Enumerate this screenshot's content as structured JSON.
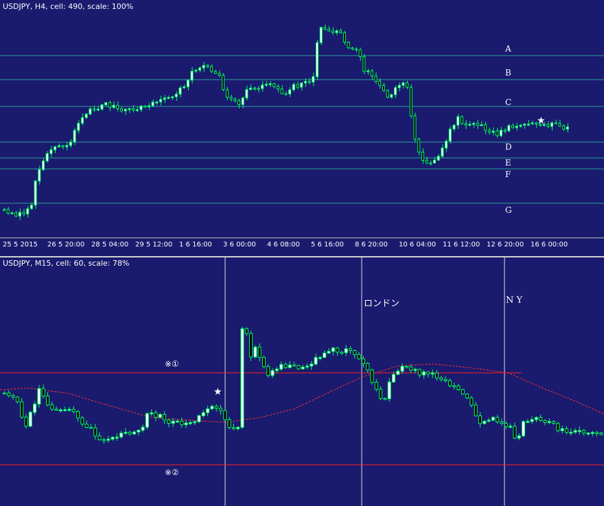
{
  "top_pane": {
    "title": "USDJPY, H4, cell: 490, scale: 100%",
    "levels": [
      {
        "label": "A"
      },
      {
        "label": "B"
      },
      {
        "label": "C"
      },
      {
        "label": "D"
      },
      {
        "label": "E"
      },
      {
        "label": "F"
      },
      {
        "label": "G"
      }
    ],
    "level_color": "#2aa198",
    "candle_up_color": "#ffffff",
    "candle_down_color": "#000000",
    "wick_color": "#00ff66",
    "marker_symbol": "★",
    "x_ticks": [
      "25 5 2015",
      "26 5 20:00",
      "28 5 04:00",
      "29 5 12:00",
      "1 6 16:00",
      "3 6 00:00",
      "4 6 08:00",
      "5 6 16:00",
      "8 6 20:00",
      "10 6 04:00",
      "11 6 12:00",
      "12 6 20:00",
      "16 6 00:00"
    ]
  },
  "bottom_pane": {
    "title": "USDJPY, M15, cell: 60, scale: 78%",
    "session_labels": [
      "ロンドン",
      "N Y"
    ],
    "level_labels": [
      "※①",
      "※②"
    ],
    "level_color": "#ff2020",
    "ma_color": "#ff3030",
    "session_line_color": "#e0e0e0",
    "marker_symbol": "★"
  }
}
